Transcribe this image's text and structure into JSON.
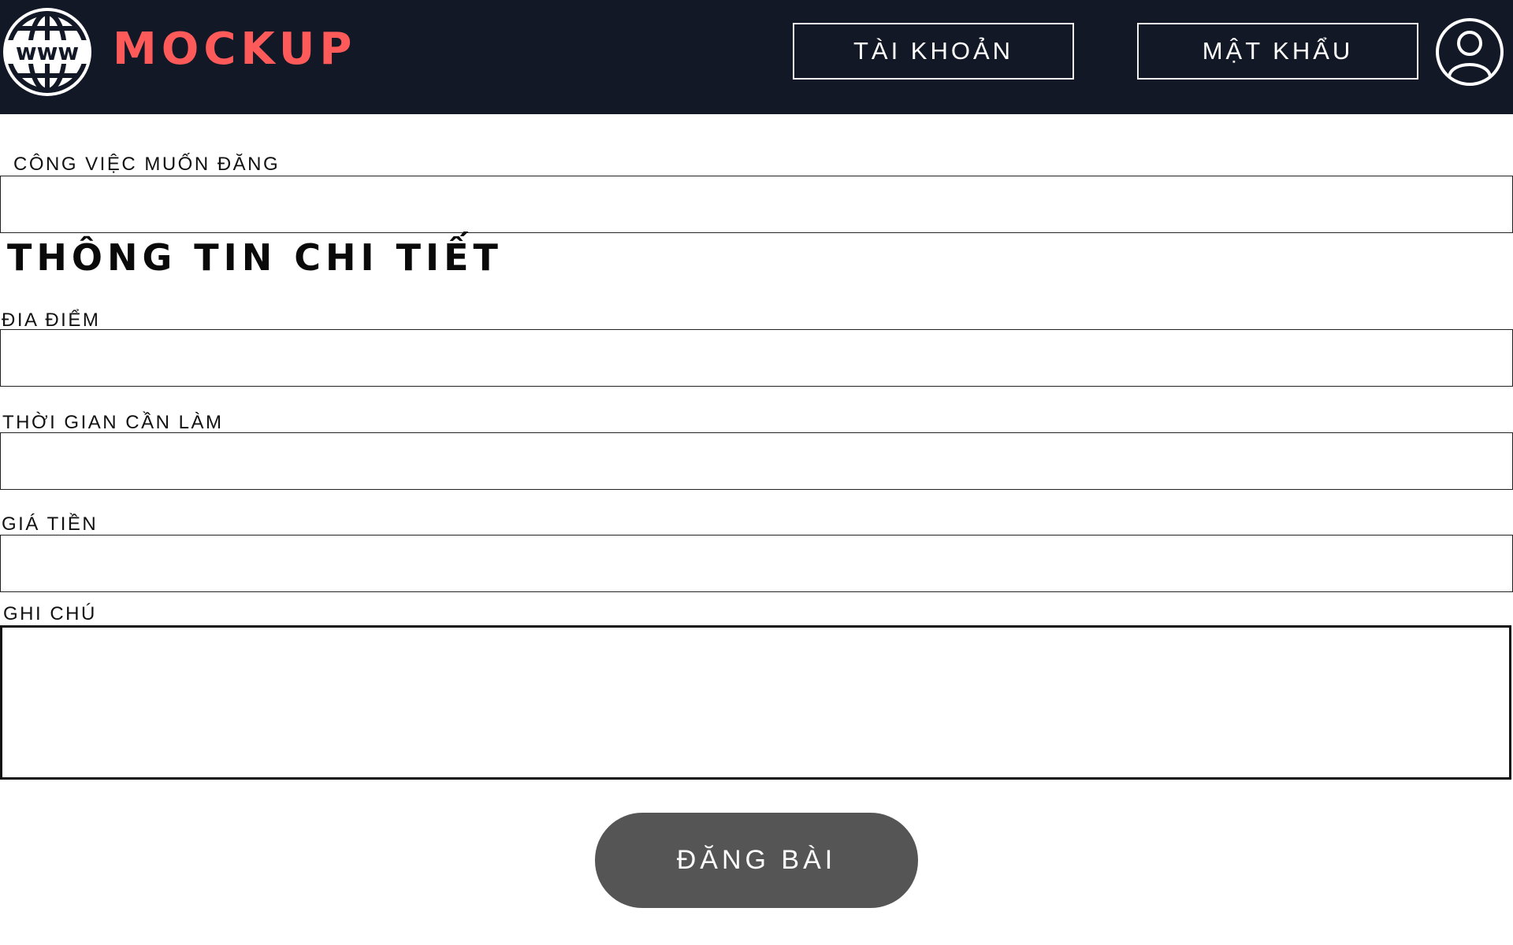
{
  "header": {
    "brand": "MOCKUP",
    "logo_icon": "www-globe-icon",
    "account_label": "TÀI KHOẢN",
    "password_label": "MẬT KHẨU",
    "avatar_icon": "user-avatar-icon",
    "colors": {
      "background": "#121826",
      "brand": "#ff5a5a"
    }
  },
  "form": {
    "job_label": "CÔNG VIỆC MUỐN ĐĂNG",
    "job_value": "",
    "section_title": "THÔNG TIN CHI TIẾT",
    "location_label": "ĐIA ĐIỂM",
    "location_value": "",
    "time_label": "THỜI GIAN CẦN LÀM",
    "time_value": "",
    "price_label": "GIÁ TIỀN",
    "price_value": "",
    "notes_label": "GHI CHÚ",
    "notes_value": "",
    "submit_label": "ĐĂNG BÀI",
    "colors": {
      "submit": "#555555"
    }
  }
}
